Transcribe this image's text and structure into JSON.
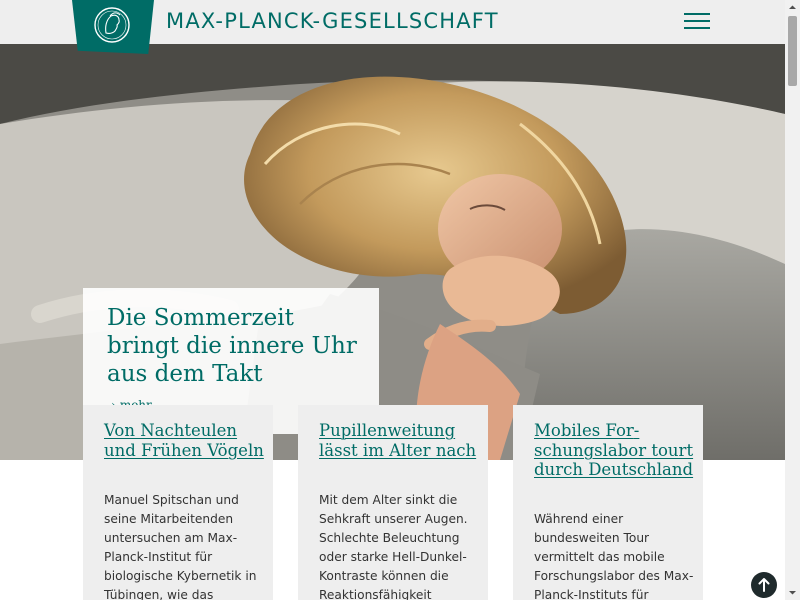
{
  "header": {
    "site_title": "MAX-PLANCK-GESELLSCHAFT",
    "logo_icon": "minerva-logo-icon",
    "menu_icon": "hamburger-menu-icon",
    "brand_color": "#006c66"
  },
  "hero": {
    "title": "Die Sommerzeit bringt die innere Uhr aus dem Takt",
    "more_label": "mehr",
    "more_icon": "chevron-right-icon"
  },
  "cards": [
    {
      "title": "Von Nachteulen und Frühen Vögeln",
      "text": "Manuel Spitschan und seine Mitarbeitenden untersuchen am Max-Planck-Institut für biologische Kybernetik in Tübingen, wie das"
    },
    {
      "title": "Pupillenweitung lässt im Alter nach",
      "text": "Mit dem Alter sinkt die Sehkraft unserer Augen. Schlechte Beleuchtung oder starke Hell-Dunkel-Kontraste können die Reaktionsfähigkeit"
    },
    {
      "title": "Mobiles For­schungslabor tourt durch Deutschland",
      "text": "Während einer bundesweiten Tour vermittelt das mobile Forschungslabor des Max-Planck-Instituts für"
    }
  ],
  "back_to_top_icon": "arrow-up-icon"
}
